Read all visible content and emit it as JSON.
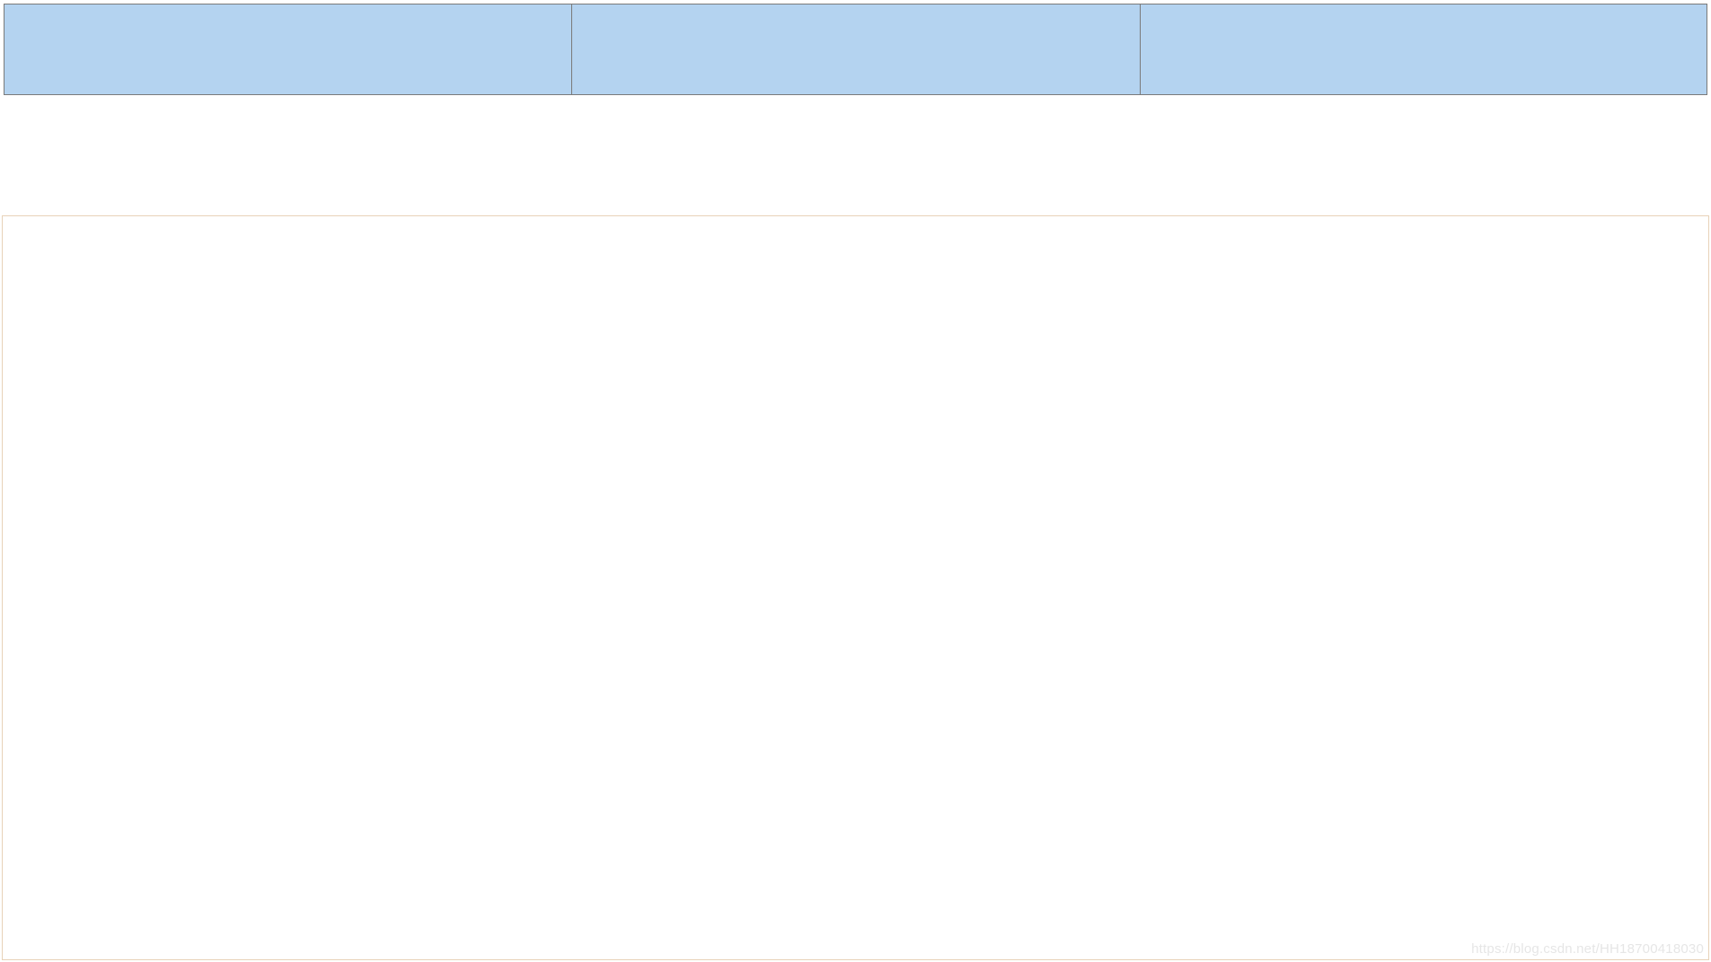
{
  "table": {
    "headers": [
      "",
      "",
      ""
    ]
  },
  "watermark": "https://blog.csdn.net/HH18700418030"
}
